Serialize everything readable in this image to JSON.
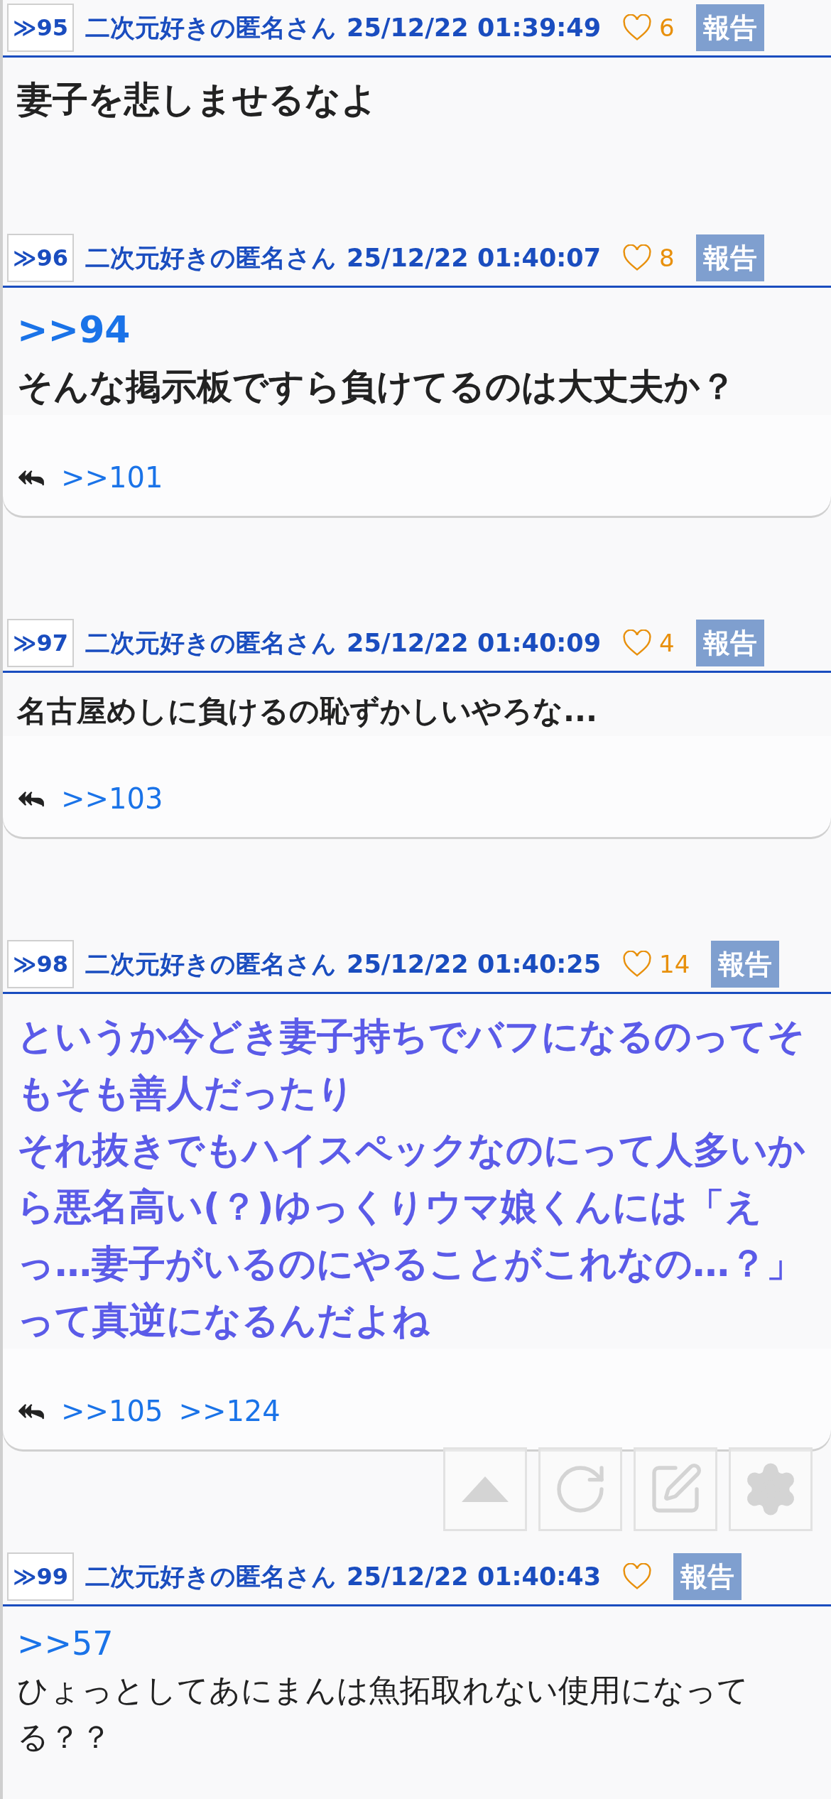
{
  "posts": [
    {
      "number": "≫95",
      "author": "二次元好きの匿名さん",
      "date": "25/12/22 01:39:49",
      "likes": "6",
      "report": "報告",
      "kind": "large-bold",
      "body": [
        {
          "kind": "text",
          "text": "妻子を悲しませるなよ"
        }
      ]
    },
    {
      "number": "≫96",
      "author": "二次元好きの匿名さん",
      "date": "25/12/22 01:40:07",
      "likes": "8",
      "report": "報告",
      "kind": "large-bold",
      "body": [
        {
          "kind": "anchor",
          "text": ">>94"
        },
        {
          "kind": "text",
          "text": "そんな掲示板ですら負けてるのは大丈夫か？"
        }
      ],
      "replies": [
        ">>101"
      ]
    },
    {
      "number": "≫97",
      "author": "二次元好きの匿名さん",
      "date": "25/12/22 01:40:09",
      "likes": "4",
      "report": "報告",
      "kind": "bold",
      "body": [
        {
          "kind": "text",
          "text": "名古屋めしに負けるの恥ずかしいやろな..."
        }
      ],
      "replies": [
        ">>103"
      ]
    },
    {
      "number": "≫98",
      "author": "二次元好きの匿名さん",
      "date": "25/12/22 01:40:25",
      "likes": "14",
      "report": "報告",
      "kind": "accent",
      "body": [
        {
          "kind": "text",
          "text": "というか今どき妻子持ちでバフになるのってそもそも善人だったり"
        },
        {
          "kind": "text",
          "text": "それ抜きでもハイスペックなのにって人多いから悪名高い(？)ゆっくりウマ娘くんには「えっ…妻子がいるのにやることがこれなの…？」って真逆になるんだよね"
        }
      ],
      "replies": [
        ">>105",
        ">>124"
      ]
    },
    {
      "number": "≫99",
      "author": "二次元好きの匿名さん",
      "date": "25/12/22 01:40:43",
      "report": "報告",
      "kind": "plain",
      "body": [
        {
          "kind": "anchor",
          "text": ">>57"
        },
        {
          "kind": "text",
          "text": "ひょっとしてあにまんは魚拓取れない使用になってる？？"
        }
      ]
    }
  ],
  "floating_buttons": [
    {
      "kind": "top"
    },
    {
      "kind": "reload"
    },
    {
      "kind": "write"
    },
    {
      "kind": "settings"
    }
  ]
}
